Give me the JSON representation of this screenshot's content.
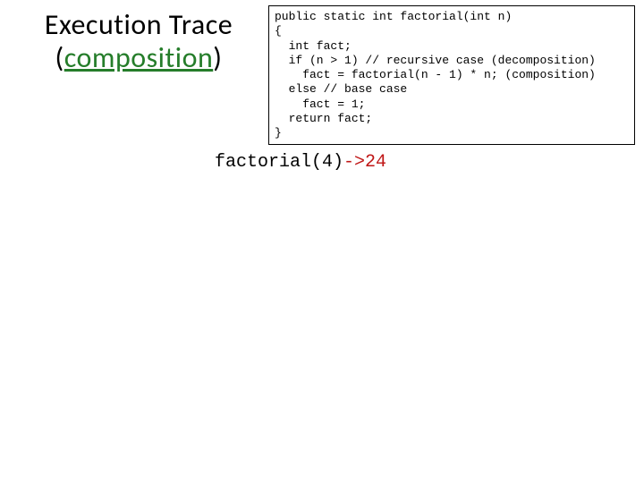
{
  "title": {
    "line1": "Execution Trace",
    "paren_open": "(",
    "accent": "composition",
    "paren_close": ")"
  },
  "code": {
    "l1": "public static int factorial(int n)",
    "l2": "{",
    "l3": "  int fact;",
    "l4": "  if (n > 1) // recursive case (decomposition)",
    "l5": "    fact = factorial(n - 1) * n; (composition)",
    "l6": "  else // base case",
    "l7": "    fact = 1;",
    "l8": "  return fact;",
    "l9": "}"
  },
  "trace": {
    "call": "factorial(4)",
    "result": "->24"
  }
}
